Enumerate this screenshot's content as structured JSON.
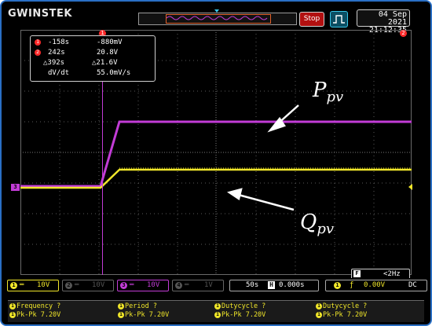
{
  "topbar": {
    "logo": "GWINSTEK",
    "status_button": "Stop",
    "date": "04 Sep 2021",
    "time": "21:12:35"
  },
  "cursors": {
    "marker1": "1",
    "marker2": "2"
  },
  "cursor_readout": {
    "rows": [
      {
        "marker": "1",
        "time": "-158s",
        "value": "-880mV"
      },
      {
        "marker": "2",
        "time": "242s",
        "value": "20.8V"
      },
      {
        "marker": "",
        "time": "△392s",
        "value": "△21.6V"
      },
      {
        "marker": "",
        "time": "dV/dt",
        "value": "55.0mV/s"
      }
    ]
  },
  "annotations": {
    "ppv_main": "P",
    "ppv_sub": "pv",
    "qpv_main": "Q",
    "qpv_sub": "pv"
  },
  "channel_marker": "3",
  "freq_counter": {
    "icon": "F",
    "value": "<2Hz"
  },
  "channels": [
    {
      "num": "1",
      "coupling": "═",
      "scale": "10V",
      "color": "#f0e62a",
      "active": true
    },
    {
      "num": "2",
      "coupling": "═",
      "scale": "10V",
      "color": "#555555",
      "active": false
    },
    {
      "num": "3",
      "coupling": "═",
      "scale": "10V",
      "color": "#c23cd6",
      "active": true
    },
    {
      "num": "4",
      "coupling": "═",
      "scale": "1V",
      "color": "#555555",
      "active": false
    }
  ],
  "timebase": {
    "scale": "50s",
    "h_icon": "H",
    "position": "0.000s"
  },
  "trigger": {
    "source": "1",
    "slope": "ƒ",
    "level": "0.00V",
    "coupling": "DC"
  },
  "measurements": [
    {
      "source": "1",
      "name": "Frequency ?",
      "value": "Pk-Pk 7.20V"
    },
    {
      "source": "1",
      "name": "Period ?",
      "value": "Pk-Pk 7.20V"
    },
    {
      "source": "1",
      "name": "Dutycycle ?",
      "value": "Pk-Pk 7.20V"
    },
    {
      "source": "1",
      "name": "Dutycycle ?",
      "value": "Pk-Pk 7.20V"
    }
  ],
  "colors": {
    "ch1": "#f0e62a",
    "ch3": "#c23cd6",
    "grid": "#5a5a5a",
    "accent": "#36c6e8",
    "stop": "#b21010"
  }
}
